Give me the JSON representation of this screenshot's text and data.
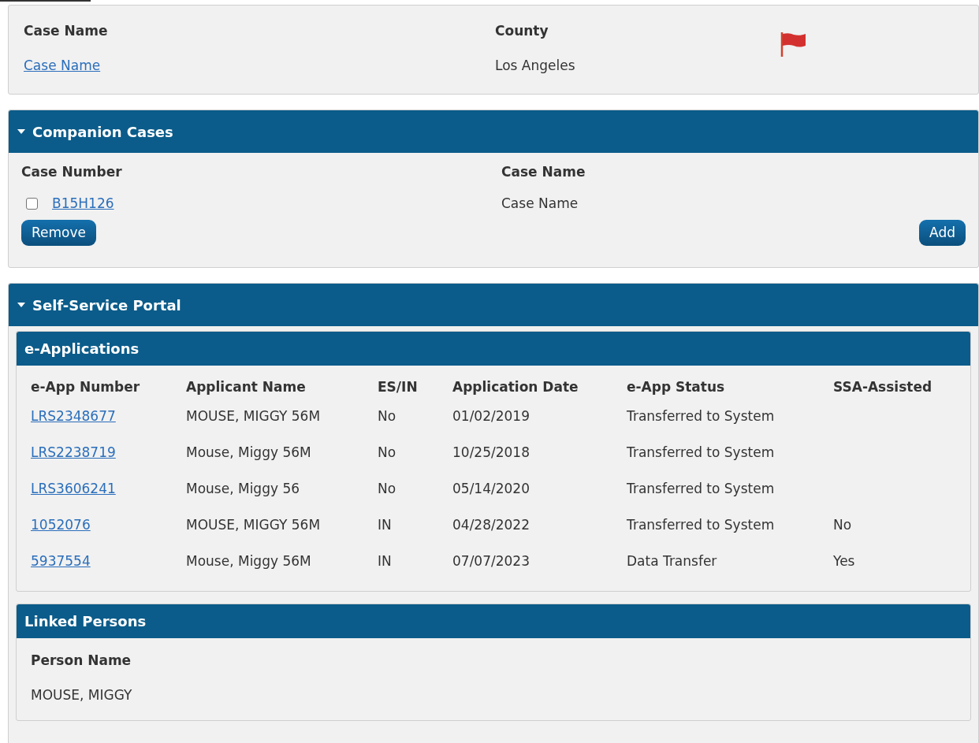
{
  "case_summary": {
    "fields": [
      {
        "label": "Case Name",
        "value": "Case Name",
        "kind": "link"
      },
      {
        "label": "County",
        "value": "Los Angeles",
        "kind": "text"
      }
    ],
    "flagged": true
  },
  "companion_cases": {
    "title": "Companion Cases",
    "expanded": true,
    "columns": [
      "Case Number",
      "Case Name"
    ],
    "rows": [
      {
        "checked": false,
        "case_number": "B15H126",
        "case_name": "Case Name"
      }
    ],
    "buttons": [
      "Remove",
      "Add"
    ]
  },
  "self_service_portal": {
    "title": "Self-Service Portal",
    "expanded": true,
    "e_applications": {
      "title": "e-Applications",
      "columns": [
        "e-App Number",
        "Applicant Name",
        "ES/IN",
        "Application Date",
        "e-App Status",
        "SSA-Assisted"
      ],
      "rows": [
        [
          "LRS2348677",
          "MOUSE, MIGGY 56M",
          "No",
          "01/02/2019",
          "Transferred to System",
          ""
        ],
        [
          "LRS2238719",
          "Mouse, Miggy 56M",
          "No",
          "10/25/2018",
          "Transferred to System",
          ""
        ],
        [
          "LRS3606241",
          "Mouse, Miggy 56",
          "No",
          "05/14/2020",
          "Transferred to System",
          ""
        ],
        [
          "1052076",
          "MOUSE, MIGGY 56M",
          "IN",
          "04/28/2022",
          "Transferred to System",
          "No"
        ],
        [
          "5937554",
          "Mouse, Miggy 56M",
          "IN",
          "07/07/2023",
          "Data Transfer",
          "Yes"
        ]
      ]
    },
    "linked_persons": {
      "title": "Linked Persons",
      "columns": [
        "Person Name"
      ],
      "rows": [
        [
          "MOUSE, MIGGY"
        ]
      ]
    }
  }
}
